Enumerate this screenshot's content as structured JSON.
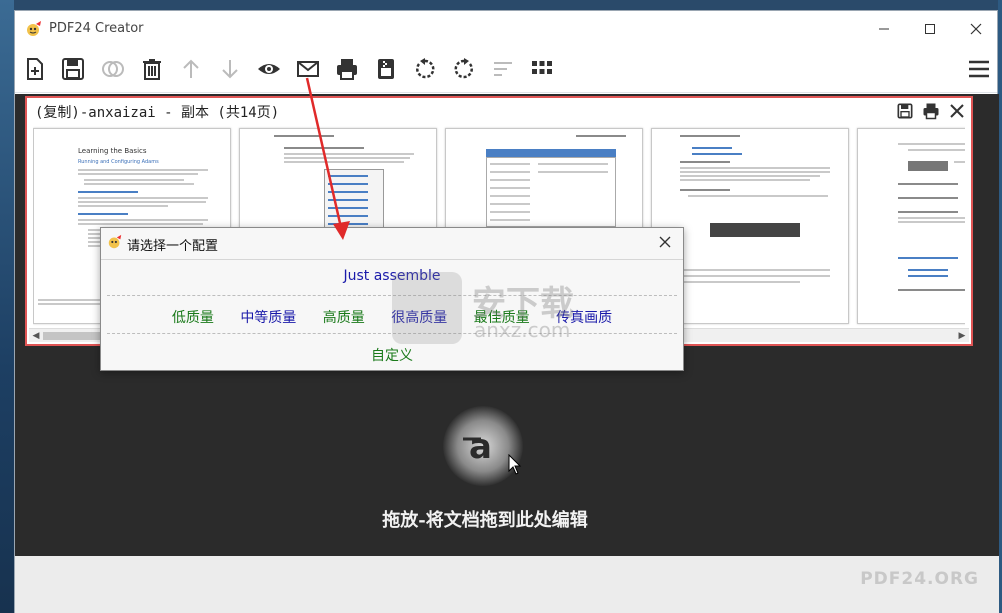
{
  "window": {
    "title": "PDF24 Creator"
  },
  "toolbar": {
    "buttons": [
      {
        "name": "add-file-icon"
      },
      {
        "name": "save-icon"
      },
      {
        "name": "merge-icon"
      },
      {
        "name": "delete-icon"
      },
      {
        "name": "move-up-icon"
      },
      {
        "name": "move-down-icon"
      },
      {
        "name": "preview-icon"
      },
      {
        "name": "email-icon"
      },
      {
        "name": "print-icon"
      },
      {
        "name": "compress-icon"
      },
      {
        "name": "rotate-left-icon"
      },
      {
        "name": "rotate-right-icon"
      },
      {
        "name": "sort-icon"
      },
      {
        "name": "grid-icon"
      },
      {
        "name": "menu-icon"
      }
    ]
  },
  "document": {
    "title": "(复制)-anxaizai - 副本 (共14页)"
  },
  "thumbnails": {
    "page1_heading": "Learning the Basics",
    "page1_subheading": "Running and Configuring Adams"
  },
  "dialog": {
    "title": "请选择一个配置",
    "option_main": "Just assemble",
    "options": [
      "低质量",
      "中等质量",
      "高质量",
      "很高质量",
      "最佳质量",
      "传真画质"
    ],
    "option_custom": "自定义"
  },
  "drop_area": {
    "text": "拖放-将文档拖到此处编辑"
  },
  "footer": {
    "brand": "PDF24.ORG"
  },
  "watermark": {
    "text": "安下载",
    "sub": "anxz.com"
  },
  "colors": {
    "accent_red": "#e05555",
    "workspace_bg": "#2b2b2b",
    "option_green": "#1a7a1a",
    "option_blue": "#1a1aaa"
  }
}
